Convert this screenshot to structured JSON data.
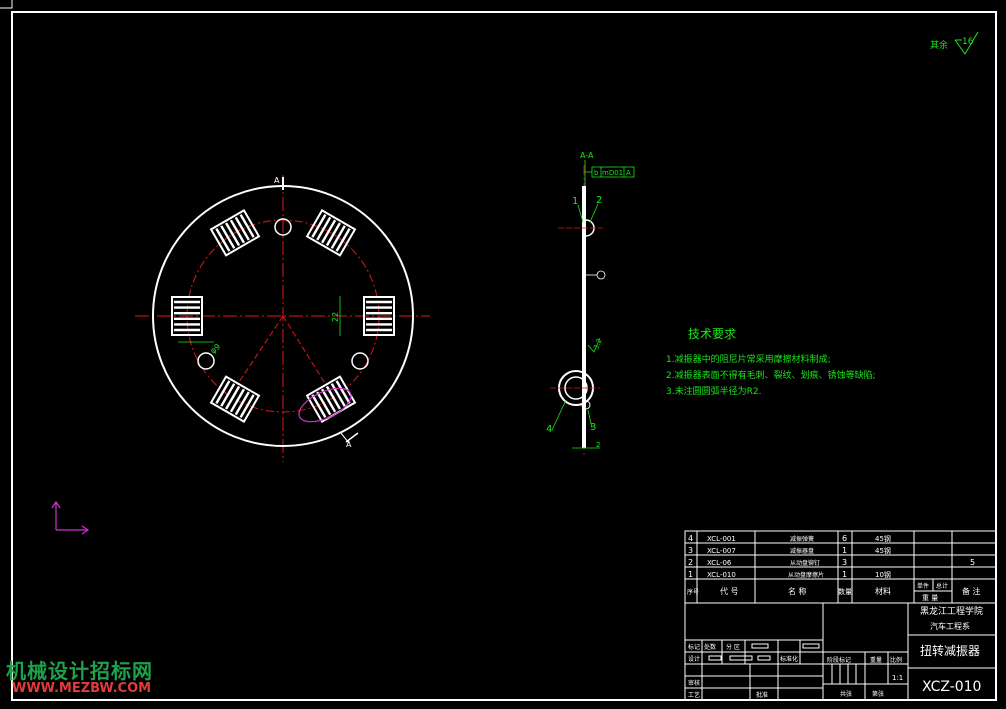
{
  "colors": {
    "background": "#000000",
    "outline": "#ffffff",
    "centerline": "#e01818",
    "dimension": "#19e619",
    "highlight": "#cc33cc",
    "ucs": "#cc33cc"
  },
  "drawing": {
    "roughness_label": "其余",
    "roughness_value": "16",
    "section_label": "A-A",
    "section_marker_top": "A",
    "section_marker_bottom": "A",
    "geometric_tolerance": [
      "b",
      "mD01",
      "A"
    ],
    "dimension_22": "22",
    "dimension_phi9": "φ9",
    "dimension_2": "2",
    "callouts": [
      "1",
      "2",
      "3",
      "4"
    ],
    "surface_marks": [
      "3.2",
      "6.3"
    ]
  },
  "tech_requirements": {
    "title": "技术要求",
    "items": [
      "1.减振器中的阻尼片常采用摩擦材料制成;",
      "2.减振器表面不得有毛刺、裂纹、划痕、锈蚀等缺陷;",
      "3.未注圆圆弧半径为R2."
    ]
  },
  "bom": {
    "rows": [
      {
        "no": "4",
        "code": "XCL-001",
        "name": "减振弹簧",
        "qty": "6",
        "material": "45钢",
        "note": ""
      },
      {
        "no": "3",
        "code": "XCL-007",
        "name": "减振器盘",
        "qty": "1",
        "material": "45钢",
        "note": ""
      },
      {
        "no": "2",
        "code": "XCL-06",
        "name": "从动盘铆钉",
        "qty": "3",
        "material": "",
        "note": "5"
      },
      {
        "no": "1",
        "code": "XCL-010",
        "name": "从动盘摩擦片",
        "qty": "1",
        "material": "10钢",
        "note": ""
      }
    ],
    "header": {
      "no": "序号",
      "code": "代 号",
      "name": "名 称",
      "qty": "数量",
      "material": "材料",
      "single": "单件",
      "total": "总计",
      "weight": "重 量",
      "note": "备 注"
    }
  },
  "title_block": {
    "institution": "黑龙江工程学院",
    "department": "汽车工程系",
    "drawing_name": "扭转减振器",
    "drawing_code": "XCZ-010",
    "stage_label": "阶段标记",
    "weight_label": "重量",
    "scale_label": "比例",
    "scale_value": "1:1",
    "sheets_label": "共张",
    "sheet_label": "第张",
    "marks_label": "标记",
    "count_label": "处数",
    "zone_label": "分 区",
    "design_label": "设计",
    "standard_label": "标准化",
    "review_label": "审核",
    "process_label": "工艺",
    "approve_label": "批准"
  },
  "watermark": {
    "line1": "机械设计招标网",
    "line2": "WWW.MEZBW.COM"
  }
}
